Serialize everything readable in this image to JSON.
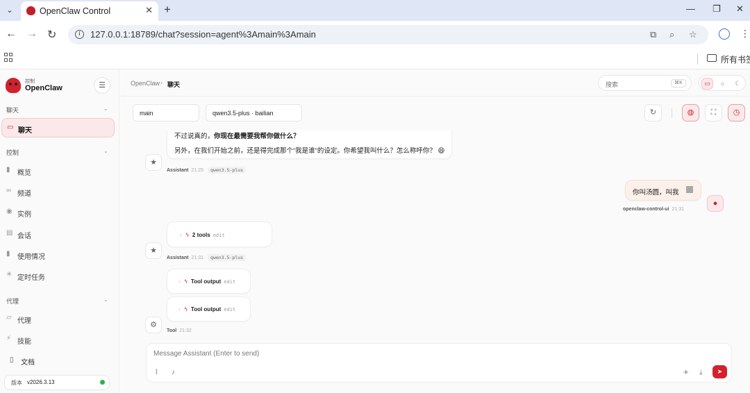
{
  "browser": {
    "tab_title": "OpenClaw Control",
    "url": "127.0.0.1:18789/chat?session=agent%3Amain%3Amain",
    "bookmarks_all": "所有书签"
  },
  "sidebar": {
    "brand_sub": "控制",
    "brand_name": "OpenClaw",
    "sections": [
      {
        "title": "聊天",
        "items": [
          {
            "label": "聊天",
            "icon": "chat-bubble-icon",
            "active": true
          }
        ]
      },
      {
        "title": "控制",
        "items": [
          {
            "label": "概览",
            "icon": "bar-chart-icon"
          },
          {
            "label": "频道",
            "icon": "link-icon"
          },
          {
            "label": "实例",
            "icon": "radio-icon"
          },
          {
            "label": "会话",
            "icon": "document-icon"
          },
          {
            "label": "使用情况",
            "icon": "bar-chart-icon"
          },
          {
            "label": "定时任务",
            "icon": "loader-icon"
          }
        ]
      },
      {
        "title": "代理",
        "items": [
          {
            "label": "代理",
            "icon": "folder-icon"
          },
          {
            "label": "技能",
            "icon": "zap-icon"
          }
        ]
      }
    ],
    "docs_label": "文档",
    "version_label": "版本",
    "version_value": "v2026.3.13",
    "status_color": "#2db24a"
  },
  "header": {
    "breadcrumb_root": "OpenClaw",
    "breadcrumb_current": "聊天",
    "search_placeholder": "搜索",
    "search_shortcut": "⌘K"
  },
  "toolbar": {
    "session_select": "main",
    "model_select": "qwen3.5-plus · bailian"
  },
  "messages": {
    "assistant1": {
      "line1_prefix": "不过说真的，",
      "line1_bold": "你现在最需要我帮你做什么？",
      "line2": "另外，在我们开始之前，还是得完成那个“我是谁”的设定。你希望我叫什么？怎么称呼你？ 😄",
      "sender": "Assistant",
      "time": "21:25",
      "model": "qwen3.5-plus"
    },
    "user1": {
      "text": "你叫汤圆，叫我",
      "sender": "openclaw-control-ui",
      "time": "21:31"
    },
    "assistant2": {
      "tools_label": "2 tools",
      "edit_label": "edit",
      "sender": "Assistant",
      "time": "21:31",
      "model": "qwen3.5-plus"
    },
    "tool1": {
      "items": [
        {
          "label": "Tool output",
          "edit": "edit"
        },
        {
          "label": "Tool output",
          "edit": "edit"
        }
      ],
      "sender": "Tool",
      "time": "21:32"
    }
  },
  "composer": {
    "placeholder": "Message Assistant (Enter to send)"
  },
  "colors": {
    "accent": "#d2222d",
    "accent_soft": "#fbe9ea"
  }
}
